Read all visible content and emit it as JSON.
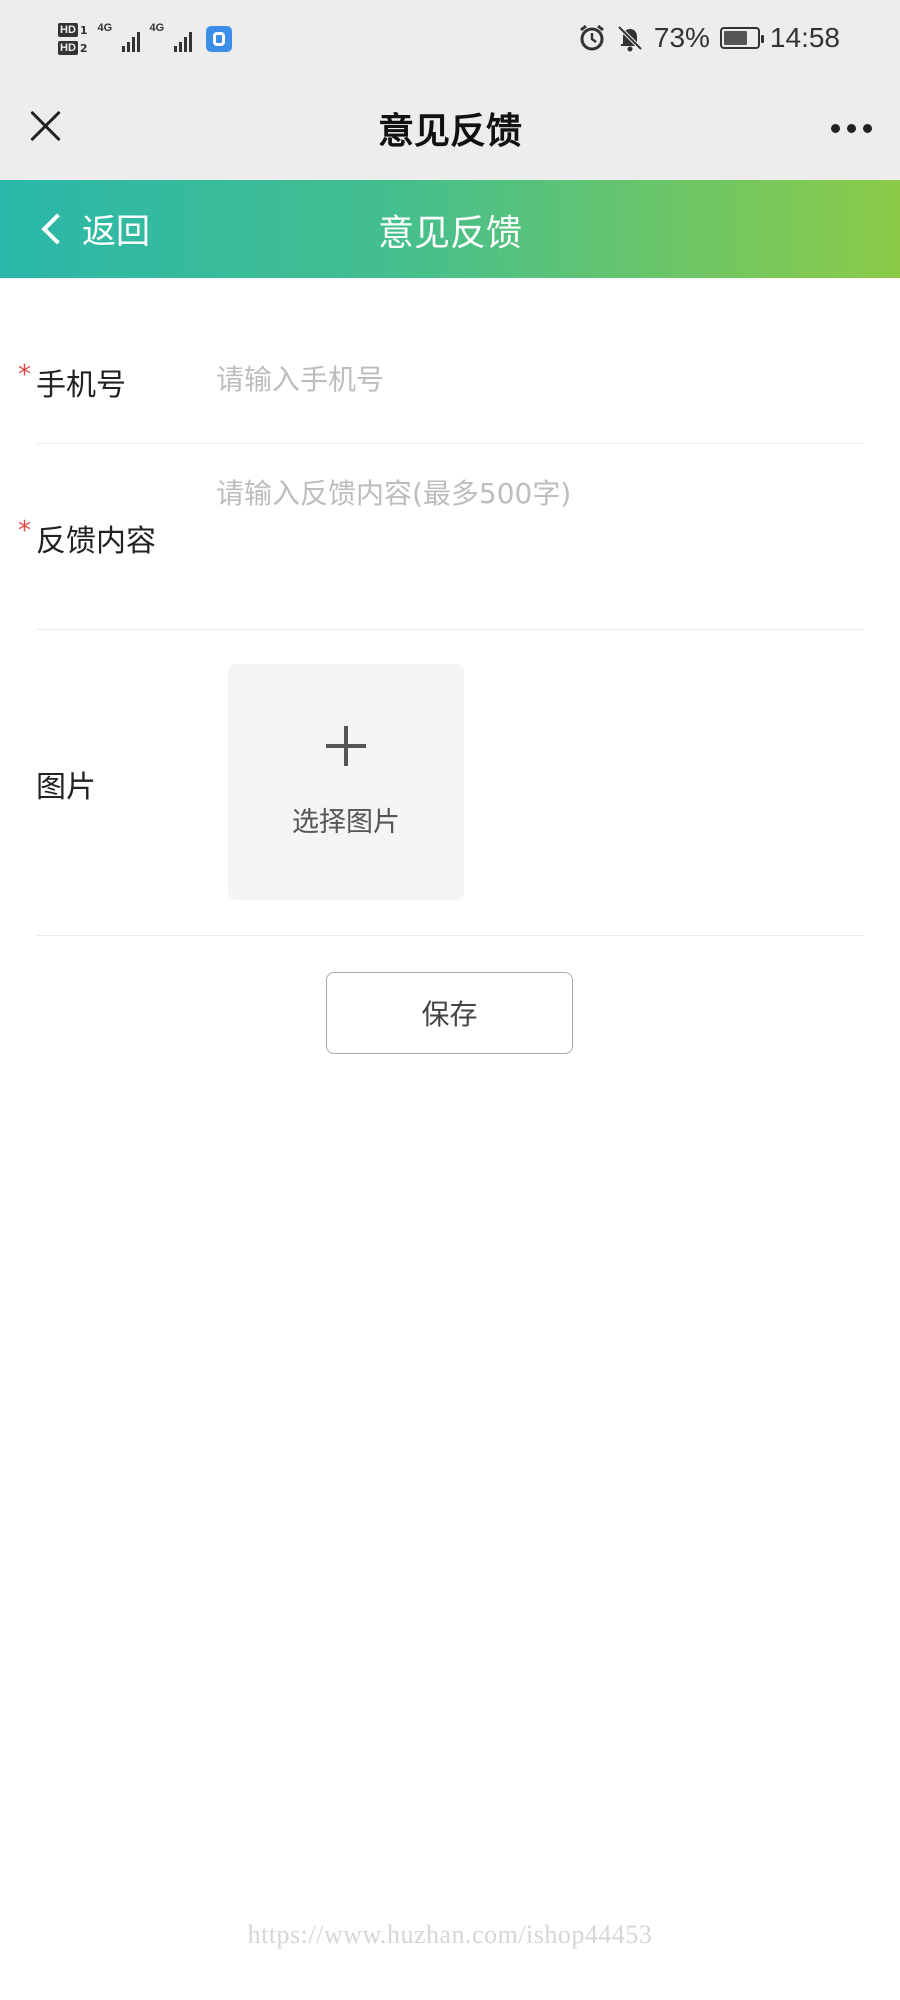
{
  "status_bar": {
    "hd1": "HD",
    "sim1": "1",
    "hd2": "HD",
    "sim2": "2",
    "net1": "4G",
    "net2": "4G",
    "battery": "73%",
    "battery_level": 0.73,
    "time": "14:58",
    "icons": [
      "alarm-icon",
      "mute-bell-icon",
      "battery-icon",
      "app-notification-icon"
    ]
  },
  "wechat_nav": {
    "title": "意见反馈",
    "icons": [
      "close-icon",
      "more-icon"
    ]
  },
  "header": {
    "back_label": "返回",
    "title": "意见反馈",
    "colors": {
      "gradient_start": "#2ab7a9",
      "gradient_end": "#8ccb48"
    }
  },
  "form": {
    "phone": {
      "label": "手机号",
      "required_mark": "*",
      "value": "",
      "placeholder": "请输入手机号"
    },
    "content": {
      "label": "反馈内容",
      "required_mark": "*",
      "value": "",
      "placeholder": "请输入反馈内容(最多500字)"
    },
    "image": {
      "label": "图片",
      "upload_label": "选择图片"
    },
    "save_label": "保存"
  },
  "watermark": "https://www.huzhan.com/ishop44453"
}
